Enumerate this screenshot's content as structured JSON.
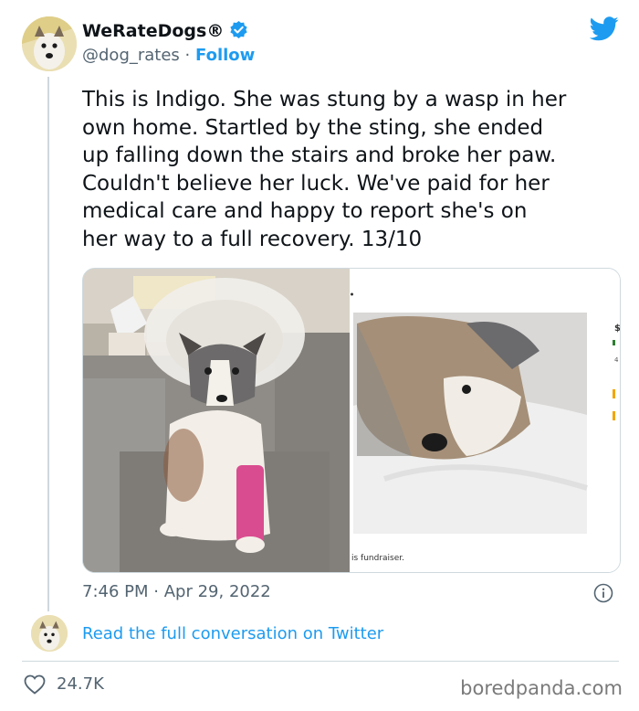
{
  "account": {
    "display_name": "WeRateDogs®",
    "handle": "@dog_rates",
    "separator": "·",
    "follow_label": "Follow"
  },
  "tweet": {
    "text": "This is Indigo. She was stung by a wasp in her\nown home. Startled by the sting, she ended\nup falling down the stairs and broke her paw.\nCouldn't believe her luck. We've paid for her\nmedical care and happy to report she's on\nher way to a full recovery. 13/10",
    "time": "7:46 PM",
    "date": "Apr 29, 2022",
    "meta_separator": "·"
  },
  "media": {
    "right_caption": "is fundraiser.",
    "right_price_glyph": "$",
    "right_small_number": "4"
  },
  "thread": {
    "read_link": "Read the full conversation on Twitter"
  },
  "actions": {
    "likes": "24.7K"
  },
  "watermark": "boredpanda.com",
  "colors": {
    "accent": "#1d9bf0",
    "secondary_text": "#536471",
    "border": "#cfd9de"
  },
  "icons": [
    "verified-badge-icon",
    "twitter-bird-icon",
    "info-icon",
    "heart-icon"
  ]
}
